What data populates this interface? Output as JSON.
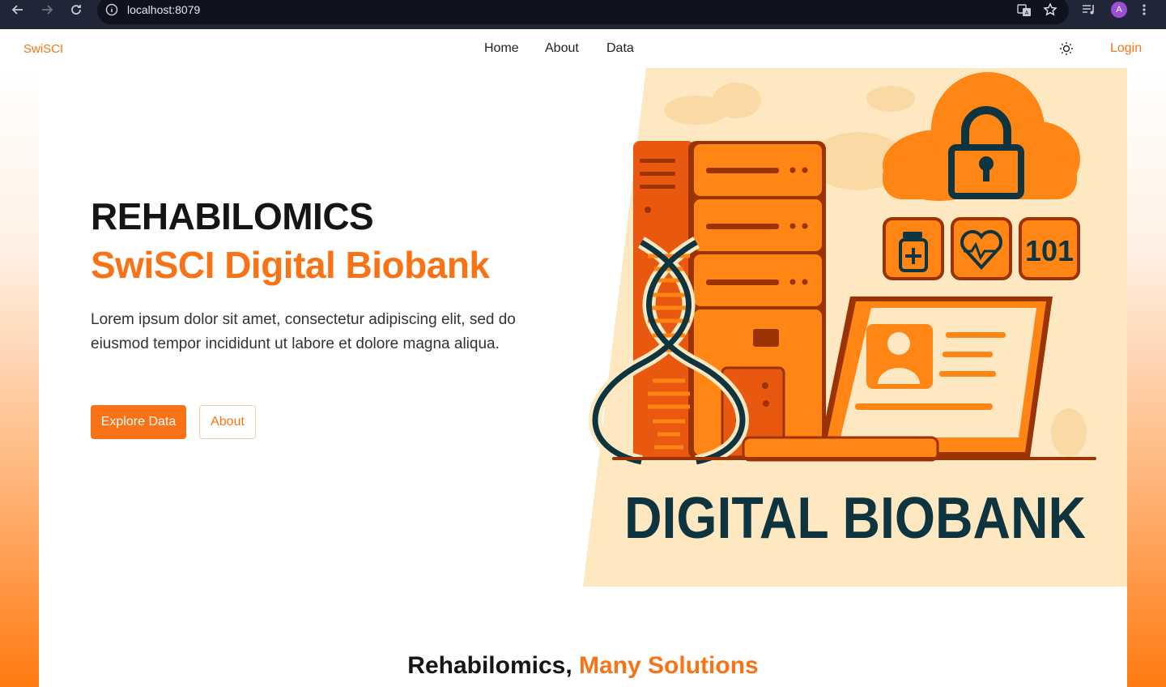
{
  "browser": {
    "url": "localhost:8079",
    "profile_initial": "A"
  },
  "nav": {
    "brand": "SwiSCI",
    "links": [
      "Home",
      "About",
      "Data"
    ],
    "login": "Login"
  },
  "hero": {
    "title": "REHABILOMICS",
    "subtitle": "SwiSCI Digital Biobank",
    "description": "Lorem ipsum dolor sit amet, consectetur adipiscing elit, sed do eiusmod tempor incididunt ut labore et dolore magna aliqua.",
    "primary_button": "Explore Data",
    "secondary_button": "About"
  },
  "illustration": {
    "banner_text": "DIGITAL BIOBANK",
    "badge_number": "101"
  },
  "section": {
    "heading_dark": "Rehabilomics,",
    "heading_orange": "Many Solutions"
  },
  "colors": {
    "accent": "#f97316",
    "dark_text": "#151515",
    "illustration_bg": "#fde8c2",
    "banner_text": "#0e3440"
  }
}
